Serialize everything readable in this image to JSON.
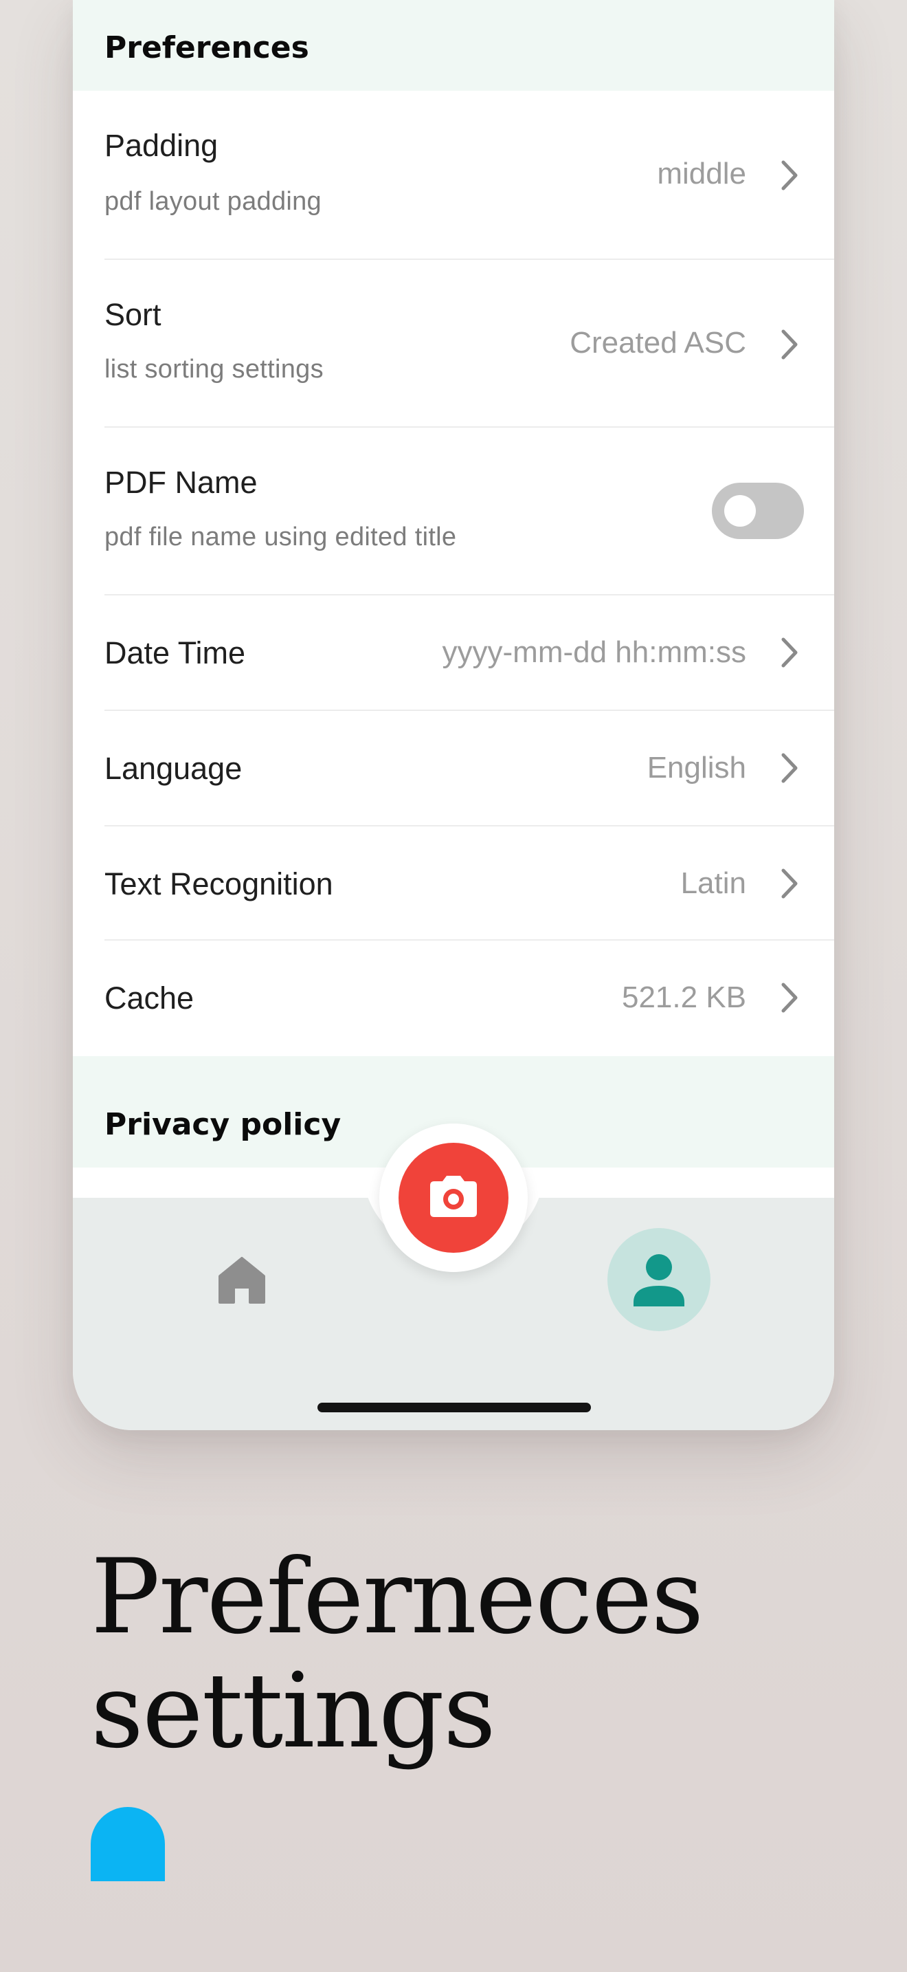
{
  "preferences": {
    "title": "Preferences",
    "items": [
      {
        "title": "Padding",
        "subtitle": "pdf layout padding",
        "value": "middle"
      },
      {
        "title": "Sort",
        "subtitle": "list sorting settings",
        "value": "Created ASC"
      },
      {
        "title": "PDF Name",
        "subtitle": "pdf file name using edited title",
        "toggle_on": false
      },
      {
        "title": "Date Time",
        "value": "yyyy-mm-dd hh:mm:ss"
      },
      {
        "title": "Language",
        "value": "English"
      },
      {
        "title": "Text Recognition",
        "value": "Latin"
      },
      {
        "title": "Cache",
        "value": "521.2 KB"
      }
    ]
  },
  "privacy": {
    "title": "Privacy policy"
  },
  "tabbar": {
    "home_icon": "home-icon",
    "camera_icon": "camera-icon",
    "profile_icon": "person-icon",
    "active_tab": "profile"
  },
  "caption": {
    "line1": "Preferneces",
    "line2": "settings"
  },
  "colors": {
    "section_background": "#f0f8f4",
    "camera_button": "#f0433a",
    "profile_active_bg": "#c6e3de",
    "profile_icon": "#12988a",
    "home_icon": "#8e8e8e",
    "accent_shape": "#0bb4f3",
    "toggle_off": "#c5c5c5"
  }
}
